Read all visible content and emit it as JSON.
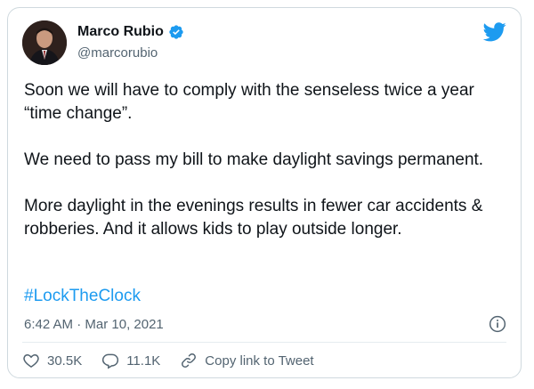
{
  "author": {
    "display_name": "Marco Rubio",
    "handle": "@marcorubio",
    "verified": true
  },
  "tweet": {
    "text": "Soon we will have to comply with the senseless twice a year “time change”.\n\nWe need to pass my bill to make daylight savings permanent.\n\nMore daylight in the evenings results in fewer car accidents & robberies. And it allows kids to play outside longer.",
    "hashtag": "#LockTheClock",
    "time": "6:42 AM",
    "date": "Mar 10, 2021",
    "separator": "·"
  },
  "actions": {
    "likes": "30.5K",
    "replies": "11.1K",
    "copy_link_label": "Copy link to Tweet"
  },
  "colors": {
    "accent": "#1d9bf0",
    "text": "#0f1419",
    "muted": "#536471",
    "border": "#cfd9de"
  },
  "icons": [
    "verified-badge-icon",
    "twitter-bird-icon",
    "info-icon",
    "heart-icon",
    "reply-icon",
    "link-icon"
  ]
}
